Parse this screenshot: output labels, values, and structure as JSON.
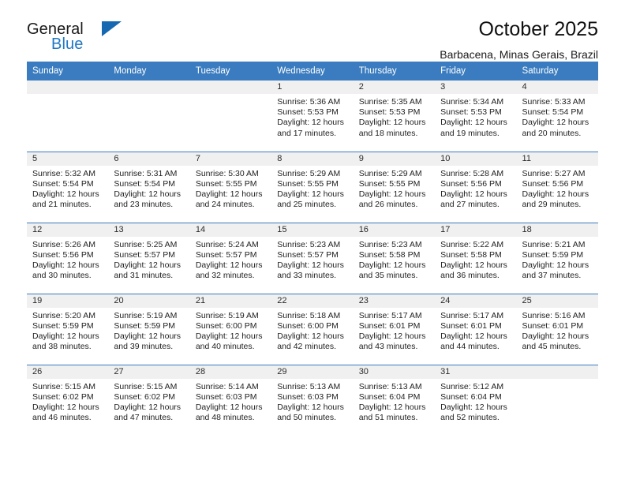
{
  "brand": {
    "name_top": "General",
    "name_bottom": "Blue",
    "accent_color": "#2077c3",
    "triangle_color": "#1668b0"
  },
  "header": {
    "title": "October 2025",
    "subtitle": "Barbacena, Minas Gerais, Brazil"
  },
  "calendar": {
    "header_bg": "#3a7cbf",
    "weekday_headers": [
      "Sunday",
      "Monday",
      "Tuesday",
      "Wednesday",
      "Thursday",
      "Friday",
      "Saturday"
    ],
    "weeks": [
      [
        {
          "day": "",
          "lines": []
        },
        {
          "day": "",
          "lines": []
        },
        {
          "day": "",
          "lines": []
        },
        {
          "day": "1",
          "lines": [
            "Sunrise: 5:36 AM",
            "Sunset: 5:53 PM",
            "Daylight: 12 hours",
            "and 17 minutes."
          ]
        },
        {
          "day": "2",
          "lines": [
            "Sunrise: 5:35 AM",
            "Sunset: 5:53 PM",
            "Daylight: 12 hours",
            "and 18 minutes."
          ]
        },
        {
          "day": "3",
          "lines": [
            "Sunrise: 5:34 AM",
            "Sunset: 5:53 PM",
            "Daylight: 12 hours",
            "and 19 minutes."
          ]
        },
        {
          "day": "4",
          "lines": [
            "Sunrise: 5:33 AM",
            "Sunset: 5:54 PM",
            "Daylight: 12 hours",
            "and 20 minutes."
          ]
        }
      ],
      [
        {
          "day": "5",
          "lines": [
            "Sunrise: 5:32 AM",
            "Sunset: 5:54 PM",
            "Daylight: 12 hours",
            "and 21 minutes."
          ]
        },
        {
          "day": "6",
          "lines": [
            "Sunrise: 5:31 AM",
            "Sunset: 5:54 PM",
            "Daylight: 12 hours",
            "and 23 minutes."
          ]
        },
        {
          "day": "7",
          "lines": [
            "Sunrise: 5:30 AM",
            "Sunset: 5:55 PM",
            "Daylight: 12 hours",
            "and 24 minutes."
          ]
        },
        {
          "day": "8",
          "lines": [
            "Sunrise: 5:29 AM",
            "Sunset: 5:55 PM",
            "Daylight: 12 hours",
            "and 25 minutes."
          ]
        },
        {
          "day": "9",
          "lines": [
            "Sunrise: 5:29 AM",
            "Sunset: 5:55 PM",
            "Daylight: 12 hours",
            "and 26 minutes."
          ]
        },
        {
          "day": "10",
          "lines": [
            "Sunrise: 5:28 AM",
            "Sunset: 5:56 PM",
            "Daylight: 12 hours",
            "and 27 minutes."
          ]
        },
        {
          "day": "11",
          "lines": [
            "Sunrise: 5:27 AM",
            "Sunset: 5:56 PM",
            "Daylight: 12 hours",
            "and 29 minutes."
          ]
        }
      ],
      [
        {
          "day": "12",
          "lines": [
            "Sunrise: 5:26 AM",
            "Sunset: 5:56 PM",
            "Daylight: 12 hours",
            "and 30 minutes."
          ]
        },
        {
          "day": "13",
          "lines": [
            "Sunrise: 5:25 AM",
            "Sunset: 5:57 PM",
            "Daylight: 12 hours",
            "and 31 minutes."
          ]
        },
        {
          "day": "14",
          "lines": [
            "Sunrise: 5:24 AM",
            "Sunset: 5:57 PM",
            "Daylight: 12 hours",
            "and 32 minutes."
          ]
        },
        {
          "day": "15",
          "lines": [
            "Sunrise: 5:23 AM",
            "Sunset: 5:57 PM",
            "Daylight: 12 hours",
            "and 33 minutes."
          ]
        },
        {
          "day": "16",
          "lines": [
            "Sunrise: 5:23 AM",
            "Sunset: 5:58 PM",
            "Daylight: 12 hours",
            "and 35 minutes."
          ]
        },
        {
          "day": "17",
          "lines": [
            "Sunrise: 5:22 AM",
            "Sunset: 5:58 PM",
            "Daylight: 12 hours",
            "and 36 minutes."
          ]
        },
        {
          "day": "18",
          "lines": [
            "Sunrise: 5:21 AM",
            "Sunset: 5:59 PM",
            "Daylight: 12 hours",
            "and 37 minutes."
          ]
        }
      ],
      [
        {
          "day": "19",
          "lines": [
            "Sunrise: 5:20 AM",
            "Sunset: 5:59 PM",
            "Daylight: 12 hours",
            "and 38 minutes."
          ]
        },
        {
          "day": "20",
          "lines": [
            "Sunrise: 5:19 AM",
            "Sunset: 5:59 PM",
            "Daylight: 12 hours",
            "and 39 minutes."
          ]
        },
        {
          "day": "21",
          "lines": [
            "Sunrise: 5:19 AM",
            "Sunset: 6:00 PM",
            "Daylight: 12 hours",
            "and 40 minutes."
          ]
        },
        {
          "day": "22",
          "lines": [
            "Sunrise: 5:18 AM",
            "Sunset: 6:00 PM",
            "Daylight: 12 hours",
            "and 42 minutes."
          ]
        },
        {
          "day": "23",
          "lines": [
            "Sunrise: 5:17 AM",
            "Sunset: 6:01 PM",
            "Daylight: 12 hours",
            "and 43 minutes."
          ]
        },
        {
          "day": "24",
          "lines": [
            "Sunrise: 5:17 AM",
            "Sunset: 6:01 PM",
            "Daylight: 12 hours",
            "and 44 minutes."
          ]
        },
        {
          "day": "25",
          "lines": [
            "Sunrise: 5:16 AM",
            "Sunset: 6:01 PM",
            "Daylight: 12 hours",
            "and 45 minutes."
          ]
        }
      ],
      [
        {
          "day": "26",
          "lines": [
            "Sunrise: 5:15 AM",
            "Sunset: 6:02 PM",
            "Daylight: 12 hours",
            "and 46 minutes."
          ]
        },
        {
          "day": "27",
          "lines": [
            "Sunrise: 5:15 AM",
            "Sunset: 6:02 PM",
            "Daylight: 12 hours",
            "and 47 minutes."
          ]
        },
        {
          "day": "28",
          "lines": [
            "Sunrise: 5:14 AM",
            "Sunset: 6:03 PM",
            "Daylight: 12 hours",
            "and 48 minutes."
          ]
        },
        {
          "day": "29",
          "lines": [
            "Sunrise: 5:13 AM",
            "Sunset: 6:03 PM",
            "Daylight: 12 hours",
            "and 50 minutes."
          ]
        },
        {
          "day": "30",
          "lines": [
            "Sunrise: 5:13 AM",
            "Sunset: 6:04 PM",
            "Daylight: 12 hours",
            "and 51 minutes."
          ]
        },
        {
          "day": "31",
          "lines": [
            "Sunrise: 5:12 AM",
            "Sunset: 6:04 PM",
            "Daylight: 12 hours",
            "and 52 minutes."
          ]
        },
        {
          "day": "",
          "lines": []
        }
      ]
    ]
  }
}
